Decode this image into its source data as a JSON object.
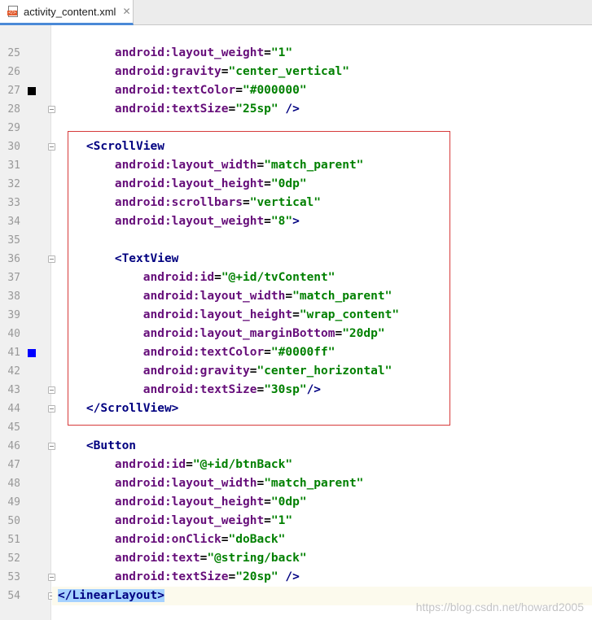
{
  "tab": {
    "filename": "activity_content.xml",
    "close_glyph": "✕",
    "icon": "xml-file-icon"
  },
  "colors": {
    "tag": "#000080",
    "attribute": "#660e7a",
    "value": "#008000",
    "highlight_box": "#d63a3a",
    "selection": "#a6d2ff",
    "marker_27": "#000000",
    "marker_41": "#0000ff"
  },
  "lines": [
    {
      "n": "25",
      "indent": 2,
      "tokens": [
        {
          "t": "android:layout_weight",
          "c": "attr"
        },
        {
          "t": "=",
          "c": "plain"
        },
        {
          "t": "\"1\"",
          "c": "val"
        }
      ]
    },
    {
      "n": "26",
      "indent": 2,
      "tokens": [
        {
          "t": "android:gravity",
          "c": "attr"
        },
        {
          "t": "=",
          "c": "plain"
        },
        {
          "t": "\"center_vertical\"",
          "c": "val"
        }
      ]
    },
    {
      "n": "27",
      "indent": 2,
      "marker": "#000000",
      "tokens": [
        {
          "t": "android:textColor",
          "c": "attr"
        },
        {
          "t": "=",
          "c": "plain"
        },
        {
          "t": "\"#000000\"",
          "c": "val"
        }
      ]
    },
    {
      "n": "28",
      "indent": 2,
      "fold": true,
      "tokens": [
        {
          "t": "android:textSize",
          "c": "attr"
        },
        {
          "t": "=",
          "c": "plain"
        },
        {
          "t": "\"25sp\"",
          "c": "val"
        },
        {
          "t": " />",
          "c": "tag"
        }
      ]
    },
    {
      "n": "29",
      "indent": 0,
      "tokens": []
    },
    {
      "n": "30",
      "indent": 1,
      "fold": true,
      "tokens": [
        {
          "t": "<ScrollView",
          "c": "tag"
        }
      ]
    },
    {
      "n": "31",
      "indent": 2,
      "tokens": [
        {
          "t": "android:layout_width",
          "c": "attr"
        },
        {
          "t": "=",
          "c": "plain"
        },
        {
          "t": "\"match_parent\"",
          "c": "val"
        }
      ]
    },
    {
      "n": "32",
      "indent": 2,
      "tokens": [
        {
          "t": "android:layout_height",
          "c": "attr"
        },
        {
          "t": "=",
          "c": "plain"
        },
        {
          "t": "\"0dp\"",
          "c": "val"
        }
      ]
    },
    {
      "n": "33",
      "indent": 2,
      "tokens": [
        {
          "t": "android:scrollbars",
          "c": "attr"
        },
        {
          "t": "=",
          "c": "plain"
        },
        {
          "t": "\"vertical\"",
          "c": "val"
        }
      ]
    },
    {
      "n": "34",
      "indent": 2,
      "tokens": [
        {
          "t": "android:layout_weight",
          "c": "attr"
        },
        {
          "t": "=",
          "c": "plain"
        },
        {
          "t": "\"8\"",
          "c": "val"
        },
        {
          "t": ">",
          "c": "tag"
        }
      ]
    },
    {
      "n": "35",
      "indent": 0,
      "tokens": []
    },
    {
      "n": "36",
      "indent": 2,
      "fold": true,
      "tokens": [
        {
          "t": "<TextView",
          "c": "tag"
        }
      ]
    },
    {
      "n": "37",
      "indent": 3,
      "tokens": [
        {
          "t": "android:id",
          "c": "attr"
        },
        {
          "t": "=",
          "c": "plain"
        },
        {
          "t": "\"@+id/tvContent\"",
          "c": "val"
        }
      ]
    },
    {
      "n": "38",
      "indent": 3,
      "tokens": [
        {
          "t": "android:layout_width",
          "c": "attr"
        },
        {
          "t": "=",
          "c": "plain"
        },
        {
          "t": "\"match_parent\"",
          "c": "val"
        }
      ]
    },
    {
      "n": "39",
      "indent": 3,
      "tokens": [
        {
          "t": "android:layout_height",
          "c": "attr"
        },
        {
          "t": "=",
          "c": "plain"
        },
        {
          "t": "\"wrap_content\"",
          "c": "val"
        }
      ]
    },
    {
      "n": "40",
      "indent": 3,
      "tokens": [
        {
          "t": "android:layout_marginBottom",
          "c": "attr"
        },
        {
          "t": "=",
          "c": "plain"
        },
        {
          "t": "\"20dp\"",
          "c": "val"
        }
      ]
    },
    {
      "n": "41",
      "indent": 3,
      "marker": "#0000ff",
      "tokens": [
        {
          "t": "android:textColor",
          "c": "attr"
        },
        {
          "t": "=",
          "c": "plain"
        },
        {
          "t": "\"#0000ff\"",
          "c": "val"
        }
      ]
    },
    {
      "n": "42",
      "indent": 3,
      "tokens": [
        {
          "t": "android:gravity",
          "c": "attr"
        },
        {
          "t": "=",
          "c": "plain"
        },
        {
          "t": "\"center_horizontal\"",
          "c": "val"
        }
      ]
    },
    {
      "n": "43",
      "indent": 3,
      "fold": true,
      "tokens": [
        {
          "t": "android:textSize",
          "c": "attr"
        },
        {
          "t": "=",
          "c": "plain"
        },
        {
          "t": "\"30sp\"",
          "c": "val"
        },
        {
          "t": "/>",
          "c": "tag"
        }
      ]
    },
    {
      "n": "44",
      "indent": 1,
      "fold": true,
      "tokens": [
        {
          "t": "</ScrollView>",
          "c": "tag"
        }
      ]
    },
    {
      "n": "45",
      "indent": 0,
      "tokens": []
    },
    {
      "n": "46",
      "indent": 1,
      "fold": true,
      "tokens": [
        {
          "t": "<Button",
          "c": "tag"
        }
      ]
    },
    {
      "n": "47",
      "indent": 2,
      "tokens": [
        {
          "t": "android:id",
          "c": "attr"
        },
        {
          "t": "=",
          "c": "plain"
        },
        {
          "t": "\"@+id/btnBack\"",
          "c": "val"
        }
      ]
    },
    {
      "n": "48",
      "indent": 2,
      "tokens": [
        {
          "t": "android:layout_width",
          "c": "attr"
        },
        {
          "t": "=",
          "c": "plain"
        },
        {
          "t": "\"match_parent\"",
          "c": "val"
        }
      ]
    },
    {
      "n": "49",
      "indent": 2,
      "tokens": [
        {
          "t": "android:layout_height",
          "c": "attr"
        },
        {
          "t": "=",
          "c": "plain"
        },
        {
          "t": "\"0dp\"",
          "c": "val"
        }
      ]
    },
    {
      "n": "50",
      "indent": 2,
      "tokens": [
        {
          "t": "android:layout_weight",
          "c": "attr"
        },
        {
          "t": "=",
          "c": "plain"
        },
        {
          "t": "\"1\"",
          "c": "val"
        }
      ]
    },
    {
      "n": "51",
      "indent": 2,
      "tokens": [
        {
          "t": "android:onClick",
          "c": "attr"
        },
        {
          "t": "=",
          "c": "plain"
        },
        {
          "t": "\"doBack\"",
          "c": "val"
        }
      ]
    },
    {
      "n": "52",
      "indent": 2,
      "tokens": [
        {
          "t": "android:text",
          "c": "attr"
        },
        {
          "t": "=",
          "c": "plain"
        },
        {
          "t": "\"@string/back\"",
          "c": "val"
        }
      ]
    },
    {
      "n": "53",
      "indent": 2,
      "fold": true,
      "tokens": [
        {
          "t": "android:textSize",
          "c": "attr"
        },
        {
          "t": "=",
          "c": "plain"
        },
        {
          "t": "\"20sp\"",
          "c": "val"
        },
        {
          "t": " />",
          "c": "tag"
        }
      ]
    },
    {
      "n": "54",
      "indent": 0,
      "current": true,
      "fold": true,
      "tokens": [
        {
          "t": "</LinearLayout>",
          "c": "tag",
          "selected": true
        }
      ]
    }
  ],
  "watermark": "https://blog.csdn.net/howard2005"
}
